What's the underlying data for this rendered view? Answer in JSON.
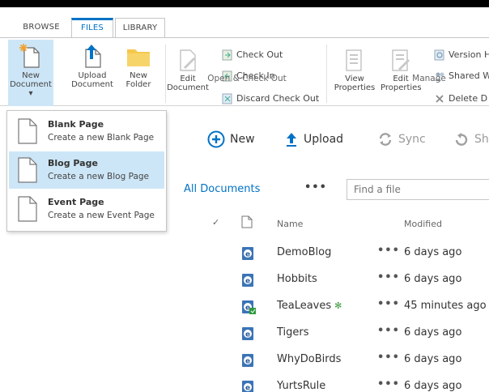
{
  "tabs": {
    "browse": "BROWSE",
    "files": "FILES",
    "library": "LIBRARY"
  },
  "ribbon": {
    "new_document": [
      "New",
      "Document"
    ],
    "upload_document": [
      "Upload",
      "Document"
    ],
    "new_folder": [
      "New",
      "Folder"
    ],
    "edit_document": [
      "Edit",
      "Document"
    ],
    "check_out": "Check Out",
    "check_in": "Check In",
    "discard_check_out": "Discard Check Out",
    "open_checkout_group": "Open & Check Out",
    "view_properties": [
      "View",
      "Properties"
    ],
    "edit_properties": [
      "Edit",
      "Properties"
    ],
    "version_history": "Version H",
    "shared_with": "Shared W",
    "delete_document": "Delete D",
    "manage_group": "Manage"
  },
  "menu": {
    "items": [
      {
        "title": "Blank Page",
        "desc": "Create a new Blank Page"
      },
      {
        "title": "Blog Page",
        "desc": "Create a new Blog Page"
      },
      {
        "title": "Event Page",
        "desc": "Create a new Event Page"
      }
    ]
  },
  "commands": {
    "new": "New",
    "upload": "Upload",
    "sync": "Sync",
    "share": "Sh"
  },
  "views": {
    "current": "All Documents",
    "more": "•••"
  },
  "search": {
    "placeholder": "Find a file"
  },
  "list": {
    "headers": {
      "name": "Name",
      "modified": "Modified"
    },
    "rows": [
      {
        "name": "DemoBlog",
        "modified": "6 days ago",
        "new": false
      },
      {
        "name": "Hobbits",
        "modified": "6 days ago",
        "new": false
      },
      {
        "name": "TeaLeaves",
        "modified": "45 minutes ago",
        "new": true,
        "new_mark": "✻"
      },
      {
        "name": "Tigers",
        "modified": "6 days ago",
        "new": false
      },
      {
        "name": "WhyDoBirds",
        "modified": "6 days ago",
        "new": false
      },
      {
        "name": "YurtsRule",
        "modified": "6 days ago",
        "new": false
      }
    ],
    "row_menu": "•••"
  },
  "colors": {
    "accent": "#0072c6",
    "selected": "#cde6f7",
    "folder": "#f5c84c",
    "new_star": "#3a9a3a"
  }
}
